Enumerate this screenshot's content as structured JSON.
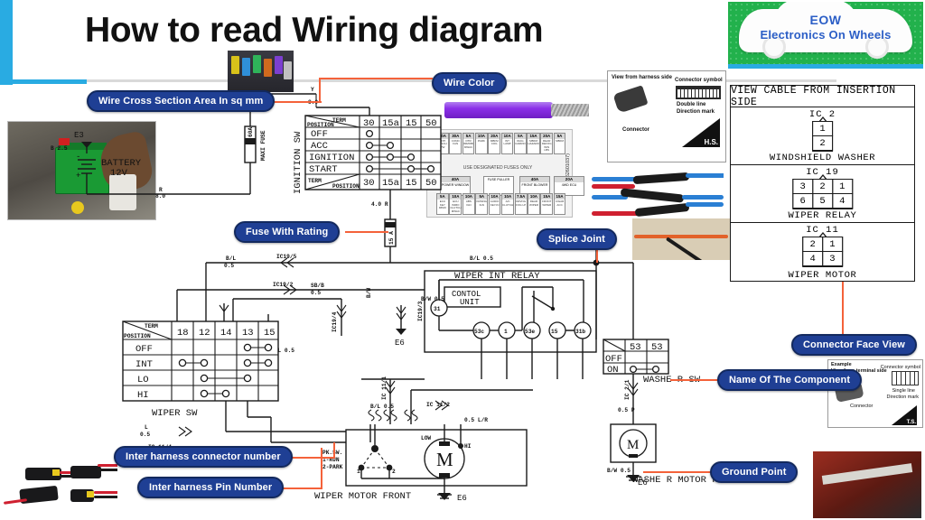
{
  "header": {
    "title": "How to read Wiring diagram",
    "accent_color": "#29ABE2"
  },
  "logo": {
    "line1": "EOW",
    "line2": "Electronics On Wheels",
    "background_color": "#22B14C",
    "text_color": "#2B5EC6"
  },
  "callouts": [
    {
      "id": "wire-cross-section",
      "label": "Wire Cross Section Area In sq mm"
    },
    {
      "id": "wire-color",
      "label": "Wire Color"
    },
    {
      "id": "fuse-with-rating",
      "label": "Fuse With Rating"
    },
    {
      "id": "splice-joint",
      "label": "Splice Joint"
    },
    {
      "id": "connector-face-view",
      "label": "Connector Face View"
    },
    {
      "id": "name-of-component",
      "label": "Name Of The Component"
    },
    {
      "id": "ground-point",
      "label": "Ground Point"
    },
    {
      "id": "inter-harness-connector-number",
      "label": "Inter harness connector number"
    },
    {
      "id": "inter-harness-pin-number",
      "label": "Inter harness Pin Number"
    }
  ],
  "callout_style": {
    "fill": "#1F3F94",
    "text": "#FFFFFF",
    "leader": "#F4623A"
  },
  "battery": {
    "ground_label": "E3",
    "name": "BATTERY",
    "voltage": "12V",
    "ground_wire": "B 2.5",
    "out_wire_color": "R",
    "out_wire_size": "8.0"
  },
  "maxi_fuse": {
    "rating": "60A",
    "label": "MAXI FUSE"
  },
  "ignition_switch": {
    "name": "IGNITION SW",
    "corner_top": "TERM",
    "corner_bottom": "POSITION",
    "terminals": [
      "30",
      "15a",
      "15",
      "50"
    ],
    "positions": [
      "OFF",
      "ACC",
      "IGNITION",
      "START"
    ],
    "contacts": {
      "OFF": [
        "30"
      ],
      "ACC": [
        "30",
        "15a"
      ],
      "IGNITION": [
        "30",
        "15a",
        "15"
      ],
      "START": [
        "30",
        "15",
        "50"
      ]
    },
    "in_wire": {
      "color": "Y",
      "size": "8.0"
    },
    "out_wire": {
      "size": "4.0",
      "color": "R"
    }
  },
  "main_fuse": {
    "rating": "15 A"
  },
  "fuse_block": {
    "brand": "MAHINDRA",
    "code": "(62601037)",
    "note": "USE DESIGNATED FUSES ONLY",
    "top_row": [
      {
        "amp": "20A",
        "name": "ANTI PINCH PW"
      },
      {
        "amp": "30A",
        "name": "COND FAN"
      },
      {
        "amp": "5A",
        "name": "DTR IMMOBI MWAC"
      },
      {
        "amp": "10A",
        "name": "PARK"
      },
      {
        "amp": "20A",
        "name": "MBFM COIL"
      },
      {
        "amp": "10A",
        "name": "INT LAMP"
      },
      {
        "amp": "5A",
        "name": "DIAG CARRIO"
      },
      {
        "amp": "15A",
        "name": "MBFM HAZARD"
      },
      {
        "amp": "20A",
        "name": "REAR DEFOG WIN LBS"
      },
      {
        "amp": "5A",
        "name": "MBFM"
      }
    ],
    "mid_row": [
      {
        "amp": "40A",
        "name": "POWER WINDOW"
      },
      {
        "amp": "",
        "name": "FUSE PULLER"
      },
      {
        "amp": "40A",
        "name": "FRONT BLOWER"
      },
      {
        "amp": "20A",
        "name": "4WD ECU"
      }
    ],
    "bottom_row": [
      {
        "amp": "5A",
        "name": "ECU KEY IMMO"
      },
      {
        "amp": "10A",
        "name": "ECU IMMO CLUTCH MWAC"
      },
      {
        "amp": "10A",
        "name": "ABS IGN"
      },
      {
        "amp": "5A",
        "name": "KRSING IGN"
      },
      {
        "amp": "10A",
        "name": "AUDIO KEY-IN"
      },
      {
        "amp": "10A",
        "name": "A/C CLUTCH"
      },
      {
        "amp": "7.5A",
        "name": "DRVNG FOG LP"
      },
      {
        "amp": "10A",
        "name": "REAR WIPER"
      },
      {
        "amp": "15A",
        "name": "FRONT WIPER"
      },
      {
        "amp": "15A",
        "name": "CIGAR ACC"
      }
    ]
  },
  "harness_side_legend": {
    "title": "View from harness side",
    "connector_label": "Connector",
    "symbol_label": "Connector symbol",
    "double_line": "Double line",
    "direction_mark": "Direction mark",
    "hs": "H.S."
  },
  "terminal_side_legend": {
    "example": "Example",
    "title": "View from terminal side",
    "connector_label": "Connector",
    "symbol_label": "Connector symbol",
    "single_line": "Single line",
    "direction_mark": "Direction mark",
    "hs": "T.S."
  },
  "connector_face_view": {
    "header": "VIEW CABLE FROM INSERTION SIDE",
    "connectors": [
      {
        "ic": "IC 2",
        "name": "WINDSHIELD WASHER",
        "rows": [
          [
            "1"
          ],
          [
            "2"
          ]
        ]
      },
      {
        "ic": "IC 19",
        "name": "WIPER RELAY",
        "rows": [
          [
            "3",
            "2",
            "1"
          ],
          [
            "6",
            "5",
            "4"
          ]
        ]
      },
      {
        "ic": "IC 11",
        "name": "WIPER MOTOR",
        "rows": [
          [
            "2",
            "1"
          ],
          [
            "4",
            "3"
          ]
        ]
      }
    ]
  },
  "wiper_switch": {
    "name": "WIPER SW",
    "corner_top": "TERM",
    "corner_bottom": "POSITION",
    "terminals": [
      "18",
      "12",
      "14",
      "13",
      "15"
    ],
    "positions": [
      "OFF",
      "INT",
      "LO",
      "HI"
    ],
    "contacts": {
      "OFF": [
        "13",
        "15"
      ],
      "INT": [
        "18",
        "12",
        "13",
        "15"
      ],
      "LO": [
        "12",
        "13"
      ],
      "HI": [
        "12",
        "14"
      ]
    }
  },
  "wiper_int_relay": {
    "name": "WIPER INT RELAY",
    "control_unit": "CONTOL UNIT",
    "terminals": [
      "31",
      "53c",
      "1",
      "53e",
      "15",
      "31b"
    ]
  },
  "washer_switch": {
    "name": "WASHE R SW",
    "terminals": [
      "53",
      "53"
    ],
    "positions": [
      "OFF",
      "ON"
    ],
    "contacts": {
      "OFF": [],
      "ON": [
        "53",
        "53"
      ]
    }
  },
  "washer_motor": {
    "name": "WASHE R MOTOR FRONT",
    "symbol": "M",
    "ground": "E6",
    "wire": "B/W 0.5"
  },
  "wiper_motor": {
    "name": "WIPER MOTOR FRONT",
    "symbol": "M",
    "ground": "E6",
    "terminal_low": "LOW",
    "terminal_hi": "HI",
    "park_note": "PK.SW. 1-RUN 2-PARK",
    "park_pins": [
      "1",
      "2"
    ]
  },
  "ground_points": [
    "E3",
    "E6"
  ],
  "wire_labels": [
    {
      "text": "Y",
      "sub": "8.0"
    },
    {
      "text": "B 2.5",
      "sub": ""
    },
    {
      "text": "R",
      "sub": "8.0"
    },
    {
      "text": "4.0 R",
      "sub": ""
    },
    {
      "text": "B/L",
      "sub": "0.5"
    },
    {
      "text": "SB/B",
      "sub": "0.5"
    },
    {
      "text": "G/L 0.5",
      "sub": ""
    },
    {
      "text": "B/W 0.5",
      "sub": ""
    },
    {
      "text": "B/L 0.5",
      "sub": ""
    },
    {
      "text": "L 0.5",
      "sub": ""
    },
    {
      "text": "0.5 L/R",
      "sub": ""
    },
    {
      "text": "0.5 P",
      "sub": ""
    }
  ],
  "connector_refs": [
    "IC19/5",
    "IC19/2",
    "IC19/4",
    "IC19/3",
    "IC 11/1",
    "IC 11/2",
    "IC 11/4",
    "IC 2/1"
  ]
}
